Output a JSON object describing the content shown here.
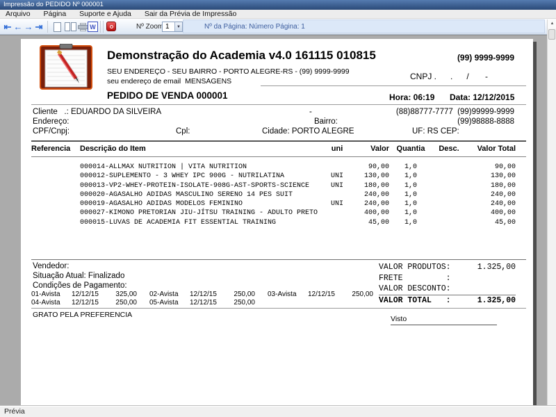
{
  "window": {
    "title": "Impressão do PEDIDO Nº 000001",
    "status": "Prévia"
  },
  "menu": [
    "Arquivo",
    "Página",
    "Suporte e Ajuda",
    "Sair da Prévia de Impressão"
  ],
  "toolbar": {
    "zoom_label": "Nº Zoom",
    "zoom_value": "1",
    "page_info": "Nº da Página: Número Página: 1"
  },
  "icons": {
    "nav_first": "⇤",
    "nav_prev": "←",
    "nav_next": "→",
    "nav_last": "⇥",
    "word": "W",
    "dropdown": "▼",
    "scroll_up": "▲"
  },
  "colors": {
    "accent_blue": "#2e6bd6",
    "danger_red": "#b80f0f",
    "page_info_text": "#3c5d9e",
    "titlebar_blue": "#2b4a78"
  },
  "doc": {
    "company": {
      "title": "Demonstração do Academia v4.0 161115 010815",
      "phone": "(99) 9999-9999",
      "address": "SEU ENDEREÇO - SEU BAIRRO - PORTO ALEGRE-RS - (99) 9999-9999",
      "email": "seu endereço de email  MENSAGENS",
      "cnpj": "CNPJ .      .      /       -"
    },
    "order": {
      "title": "PEDIDO DE VENDA 000001",
      "time": "Hora: 06:19",
      "date": "Data: 12/12/2015"
    },
    "client": {
      "line1": "Cliente   .: EDUARDO DA SILVEIRA",
      "dash": "-",
      "phones1": "(88)88777-7777  (99)99999-9999",
      "endereco": "Endereço:",
      "bairro": "Bairro:",
      "phone2": "(99)98888-8888",
      "cpf": "CPF/Cnpj:",
      "cpl": "Cpl:",
      "cidade": "Cidade: PORTO ALEGRE",
      "uf_cep": "UF: RS CEP:"
    },
    "table": {
      "headers": [
        "Referencia",
        "Descrição do Item",
        "uni",
        "Valor",
        "Quantia",
        "Desc.",
        "Valor Total"
      ]
    },
    "items": [
      {
        "d": "000014-ALLMAX NUTRITION | VITA NUTRITION",
        "u": "",
        "v": "90,00",
        "q": "1,0",
        "dc": "",
        "t": "90,00"
      },
      {
        "d": "000012-SUPLEMENTO - 3 WHEY IPC 900G - NUTRILATINA",
        "u": "UNI",
        "v": "130,00",
        "q": "1,0",
        "dc": "",
        "t": "130,00"
      },
      {
        "d": "000013-VP2-WHEY-PROTEIN-ISOLATE-908G-AST-SPORTS-SCIENCE",
        "u": "UNI",
        "v": "180,00",
        "q": "1,0",
        "dc": "",
        "t": "180,00"
      },
      {
        "d": "000020-AGASALHO ADIDAS MASCULINO SERENO 14 PES SUIT",
        "u": "",
        "v": "240,00",
        "q": "1,0",
        "dc": "",
        "t": "240,00"
      },
      {
        "d": "000019-AGASALHO ADIDAS MODELOS FEMININO",
        "u": "UNI",
        "v": "240,00",
        "q": "1,0",
        "dc": "",
        "t": "240,00"
      },
      {
        "d": "000027-KIMONO PRETORIAN JIU-JÍTSU TRAINING - ADULTO PRETO",
        "u": "",
        "v": "400,00",
        "q": "1,0",
        "dc": "",
        "t": "400,00"
      },
      {
        "d": "000015-LUVAS DE ACADEMIA FIT ESSENTIAL TRAINING",
        "u": "",
        "v": "45,00",
        "q": "1,0",
        "dc": "",
        "t": "45,00"
      }
    ],
    "footer": {
      "vendedor": "Vendedor:",
      "situacao": "Situação Atual: Finalizado",
      "condicoes": "Condições de Pagamento:",
      "thanks": "GRATO PELA PREFERENCIA",
      "visto": "Visto"
    },
    "totals": [
      {
        "label": "VALOR PRODUTOS:",
        "value": "1.325,00"
      },
      {
        "label": "FRETE         :",
        "value": ""
      },
      {
        "label": "VALOR DESCONTO:",
        "value": ""
      },
      {
        "label": "VALOR TOTAL   :",
        "value": "1.325,00"
      }
    ],
    "payments": [
      {
        "n": "01-Avista",
        "d": "12/12/15",
        "v": "325,00"
      },
      {
        "n": "02-Avista",
        "d": "12/12/15",
        "v": "250,00"
      },
      {
        "n": "03-Avista",
        "d": "12/12/15",
        "v": "250,00"
      },
      {
        "n": "04-Avista",
        "d": "12/12/15",
        "v": "250,00"
      },
      {
        "n": "05-Avista",
        "d": "12/12/15",
        "v": "250,00"
      }
    ]
  }
}
